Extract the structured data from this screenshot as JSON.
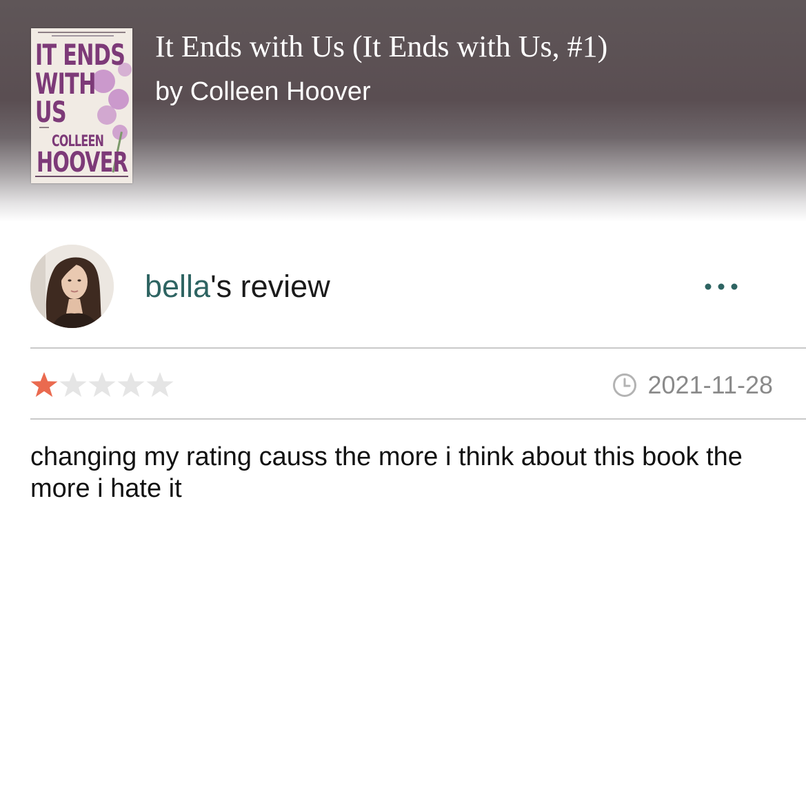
{
  "book": {
    "title": "It Ends with Us (It Ends with Us, #1)",
    "author_line": "by Colleen Hoover",
    "cover": {
      "title_line_1": "IT ENDS",
      "title_line_2": "WITH",
      "title_line_3": "US",
      "author_first": "COLLEEN",
      "author_last": "HOOVER"
    }
  },
  "review": {
    "reviewer_name": "bella",
    "title_suffix": "'s review",
    "rating": 1,
    "max_rating": 5,
    "date": "2021-11-28",
    "body": "changing my rating causs the more i think about this book the more i hate it"
  },
  "colors": {
    "reviewer_link": "#2e6462",
    "star_filled": "#ea6a4f",
    "star_empty": "#e5e5e5",
    "more_menu": "#2e6462"
  },
  "icons": {
    "more": "more-options-icon",
    "date": "clock-icon",
    "star": "star-icon"
  }
}
